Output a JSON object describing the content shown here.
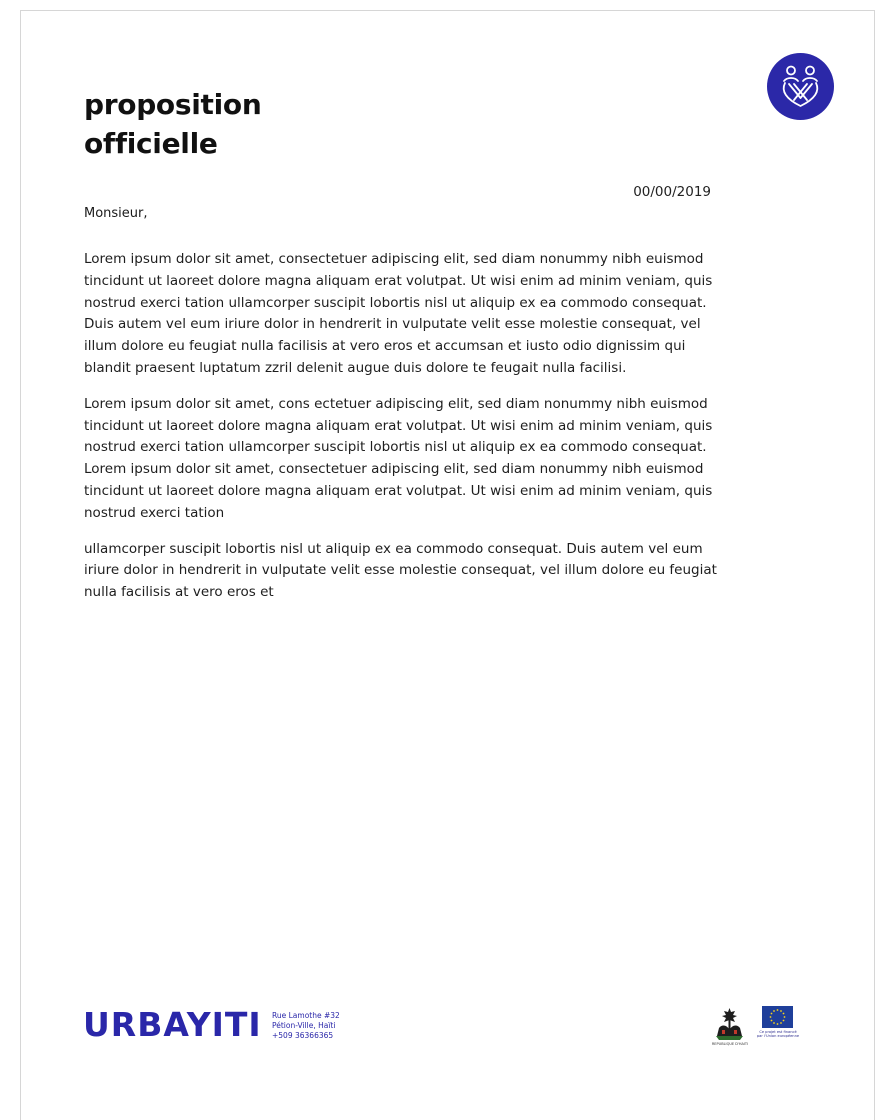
{
  "document": {
    "title_line1": "proposition",
    "title_line2": "officielle",
    "date": "00/00/2019",
    "salutation": "Monsieur,",
    "paragraphs": [
      "Lorem ipsum dolor sit amet, consectetuer adipiscing elit, sed diam nonummy nibh euismod tincidunt ut laoreet dolore magna aliquam erat volutpat. Ut wisi enim ad minim veniam, quis nostrud exerci tation ullamcorper suscipit lobortis nisl ut aliquip ex ea commodo consequat. Duis autem vel eum iriure dolor in hendrerit in vulputate velit esse molestie consequat, vel illum dolore eu feugiat nulla facilisis at vero eros et accumsan et iusto odio dignissim qui blandit praesent luptatum zzril delenit augue duis dolore te feugait nulla facilisi.",
      "Lorem ipsum dolor sit amet, cons ectetuer adipiscing elit, sed diam nonummy nibh euismod tincidunt ut laoreet dolore magna aliquam erat volutpat. Ut wisi enim ad minim veniam, quis nostrud exerci tation ullamcorper suscipit lobortis nisl ut aliquip ex ea commodo consequat.",
      "Lorem ipsum dolor sit amet, consectetuer adipiscing elit, sed diam nonummy nibh euismod tincidunt ut laoreet dolore magna aliquam erat volutpat. Ut wisi enim ad minim veniam, quis nostrud exerci tation",
      "ullamcorper suscipit lobortis nisl ut aliquip ex ea commodo consequat. Duis autem vel eum iriure dolor in hendrerit in vulputate velit esse molestie consequat, vel illum dolore eu feugiat nulla facilisis at vero eros et"
    ]
  },
  "footer": {
    "brand": "URBAYITI",
    "address_line1": "Rue Lamothe #32",
    "address_line2": "Pétion-Ville, Haïti",
    "address_line3": "+509 36366365",
    "seal_caption": "REPUBLIQUE D'HAITI",
    "eu_caption_line1": "Ce projet est financé",
    "eu_caption_line2": "par l'Union européenne"
  },
  "icons": {
    "logo": "urbayiti-people-logo-icon",
    "seal": "haiti-coat-of-arms-icon",
    "flag": "eu-flag-icon"
  },
  "colors": {
    "brand_blue": "#2a27a9",
    "logo_circle": "#2b28a8",
    "eu_blue": "#1f3f9a",
    "eu_star": "#f6d21a"
  }
}
